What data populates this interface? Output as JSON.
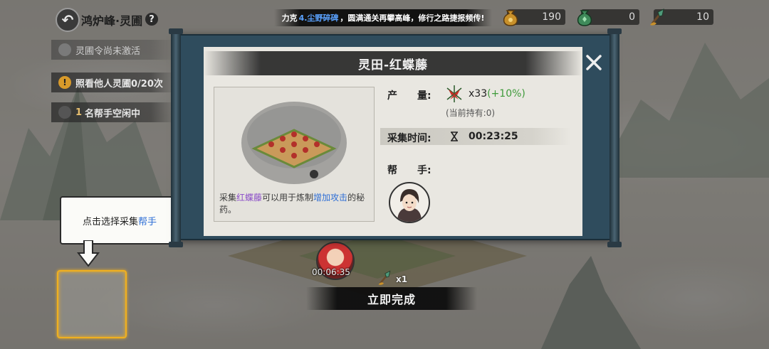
{
  "header": {
    "location_title": "鸿炉峰·灵圃",
    "ticker": {
      "prefix": "力克",
      "highlight": "4.尘野碎碑",
      "suffix": "，圆满通关再攀高峰，修行之路捷报频传!"
    },
    "resources": [
      {
        "icon": "gold-sack-icon",
        "value": "190"
      },
      {
        "icon": "green-gem-bag-icon",
        "value": "0"
      },
      {
        "icon": "shovel-icon",
        "value": "10"
      }
    ]
  },
  "side_panel": {
    "token_status": "灵圃令尚未激活",
    "view_others": "照看他人灵圃0/20次",
    "helpers_idle_count": "1",
    "helpers_idle_text": "名帮手空闲中"
  },
  "tutorial": {
    "prefix": "点击选择采集",
    "highlight": "帮手"
  },
  "bottom": {
    "timer": "00:06:35",
    "quantity": "x1",
    "finish_button": "立即完成"
  },
  "modal": {
    "title": "灵田-红蝶藤",
    "output_label": "产　　量:",
    "output_amount": "x33",
    "output_bonus": "(+10%)",
    "holding": "(当前持有:0)",
    "time_label": "采集时间:",
    "time_value": "00:23:25",
    "helper_label": "帮　　手:",
    "desc": {
      "p1": "采集",
      "item": "红蝶藤",
      "p2": "可以用于炼制",
      "effect": "增加攻击",
      "p3": "的秘药。"
    }
  },
  "colors": {
    "scroll_frame": "#2f4c5d",
    "paper": "#e9e7e1",
    "highlight_blue": "#2f6fd6",
    "bonus_green": "#3e9a3a",
    "item_purple": "#8a4cc8",
    "focus_gold": "#f0b020"
  }
}
